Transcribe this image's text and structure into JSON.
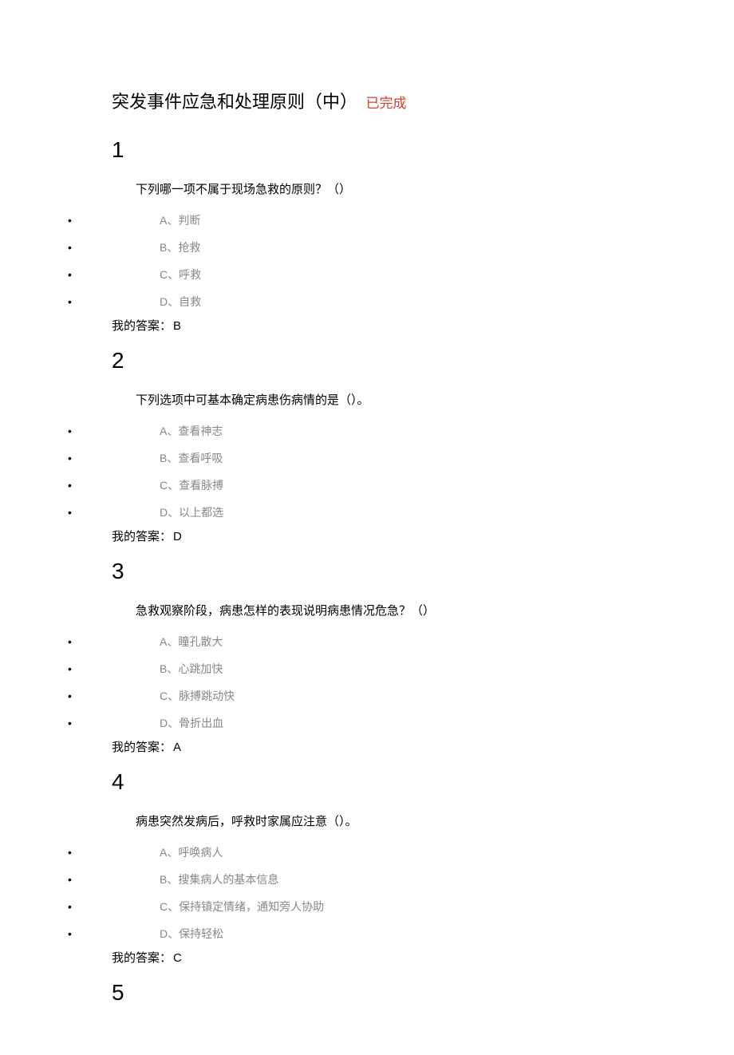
{
  "header": {
    "title": "突发事件应急和处理原则（中）",
    "status": "已完成"
  },
  "answer_prefix": "我的答案：",
  "questions": [
    {
      "number": "1",
      "text": "下列哪一项不属于现场急救的原则？（）",
      "options": [
        {
          "label": "A、",
          "text": "判断"
        },
        {
          "label": "B、",
          "text": "抢救"
        },
        {
          "label": "C、",
          "text": "呼救"
        },
        {
          "label": "D、",
          "text": "自救"
        }
      ],
      "answer": "B"
    },
    {
      "number": "2",
      "text": "下列选项中可基本确定病患伤病情的是（）。",
      "options": [
        {
          "label": "A、",
          "text": "查看神志"
        },
        {
          "label": "B、",
          "text": "查看呼吸"
        },
        {
          "label": "C、",
          "text": "查看脉搏"
        },
        {
          "label": "D、",
          "text": "以上都选"
        }
      ],
      "answer": "D"
    },
    {
      "number": "3",
      "text": "急救观察阶段，病患怎样的表现说明病患情况危急？（）",
      "options": [
        {
          "label": "A、",
          "text": "瞳孔散大"
        },
        {
          "label": "B、",
          "text": "心跳加快"
        },
        {
          "label": "C、",
          "text": "脉搏跳动快"
        },
        {
          "label": "D、",
          "text": "骨折出血"
        }
      ],
      "answer": "A"
    },
    {
      "number": "4",
      "text": "病患突然发病后，呼救时家属应注意（）。",
      "options": [
        {
          "label": "A、",
          "text": "呼唤病人"
        },
        {
          "label": "B、",
          "text": "搜集病人的基本信息"
        },
        {
          "label": "C、",
          "text": "保持镇定情绪，通知旁人协助"
        },
        {
          "label": "D、",
          "text": "保持轻松"
        }
      ],
      "answer": "C"
    },
    {
      "number": "5"
    }
  ]
}
